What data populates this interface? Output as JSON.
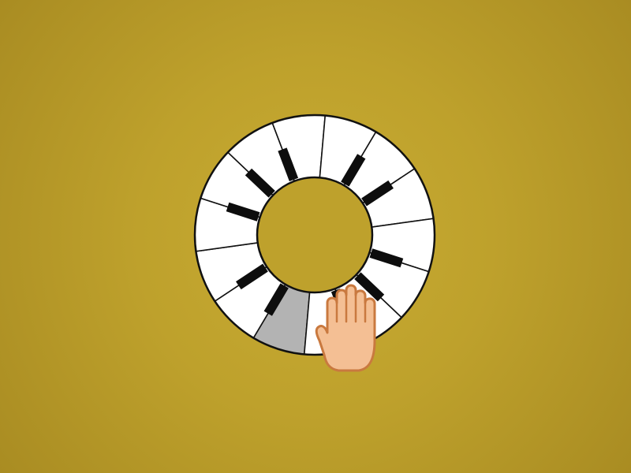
{
  "game": {
    "type": "circular-piano",
    "octaves": 2,
    "white_keys_per_octave": 7,
    "black_key_pattern": [
      1,
      1,
      0,
      1,
      1,
      1,
      0
    ],
    "pressed_white_key_index": 0,
    "colors": {
      "background": "#bea12c",
      "white_key": "#ffffff",
      "black_key": "#0d0d0d",
      "key_outline": "#111111",
      "pressed_key": "#b3b3b3",
      "hand_fill": "#f4bf94",
      "hand_outline": "#c9793f"
    }
  },
  "cursor": {
    "icon": "hand-cursor-icon",
    "state": "pressing"
  }
}
